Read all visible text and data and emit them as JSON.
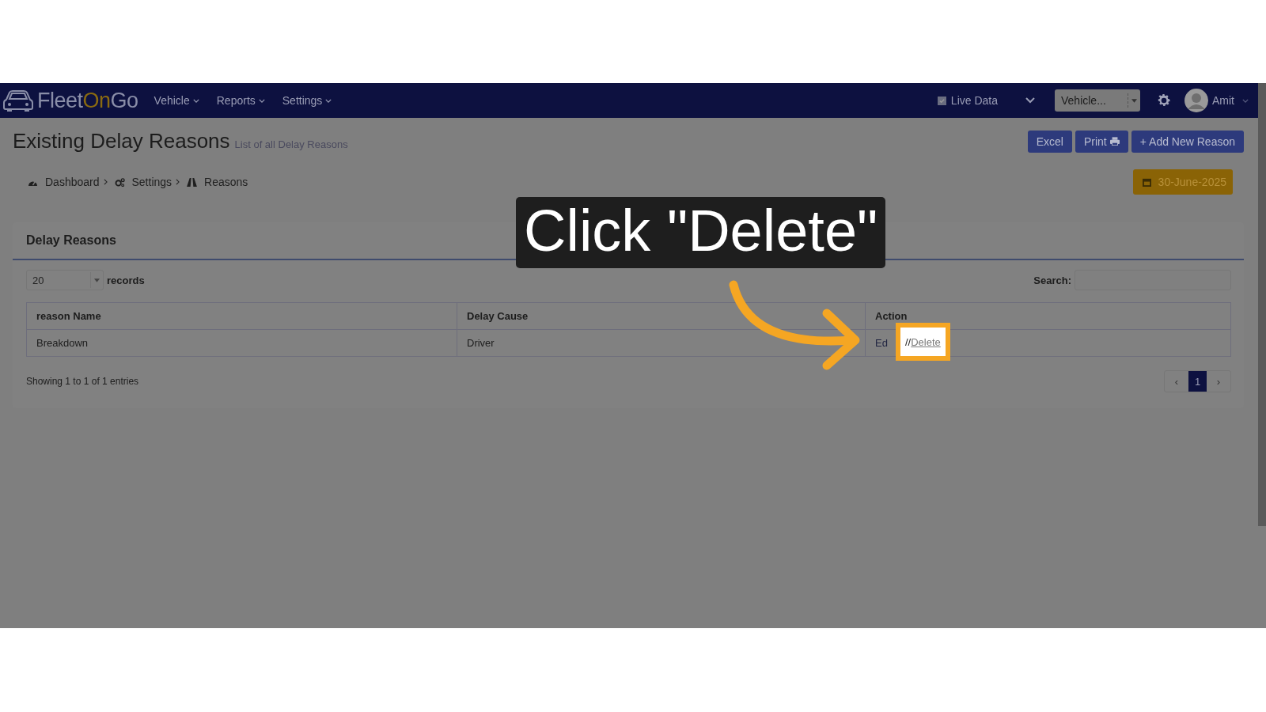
{
  "navbar": {
    "logo_prefix": "Fleet",
    "logo_on": "On",
    "logo_go": "Go",
    "menu": [
      {
        "label": "Vehicle"
      },
      {
        "label": "Reports"
      },
      {
        "label": "Settings"
      }
    ],
    "live_data": {
      "label": "Live Data",
      "checked": true
    },
    "vehicle_select": {
      "value": "Vehicle..."
    },
    "user": {
      "name": "Amit"
    }
  },
  "page": {
    "title": "Existing Delay Reasons",
    "subtitle": "List of all Delay Reasons",
    "buttons": [
      {
        "label": "Excel",
        "kind": "plain"
      },
      {
        "label": "Print",
        "kind": "print"
      },
      {
        "label": "+ Add New Reason",
        "kind": "plain"
      }
    ],
    "breadcrumb": [
      {
        "label": "Dashboard",
        "kind": "dashboard"
      },
      {
        "label": "Settings",
        "kind": "settings"
      },
      {
        "label": "Reasons",
        "kind": "reasons"
      }
    ],
    "date": "30-June-2025"
  },
  "card": {
    "title": "Delay Reasons",
    "page_size": "20",
    "records_label": "records",
    "search_label": "Search:",
    "table": {
      "columns": [
        "reason Name",
        "Delay Cause",
        "Action"
      ],
      "rows": [
        {
          "reason_name": "Breakdown",
          "delay_cause": "Driver",
          "action_edit": "Ed",
          "action_separator": "//",
          "action_delete": "Delete"
        }
      ]
    },
    "info": "Showing 1 to 1 of 1 entries",
    "pagination": [
      {
        "label": "‹",
        "selected": false
      },
      {
        "label": "1",
        "selected": true
      },
      {
        "label": "›",
        "selected": false
      }
    ]
  },
  "annotation": {
    "callout": "Click \"Delete\""
  }
}
